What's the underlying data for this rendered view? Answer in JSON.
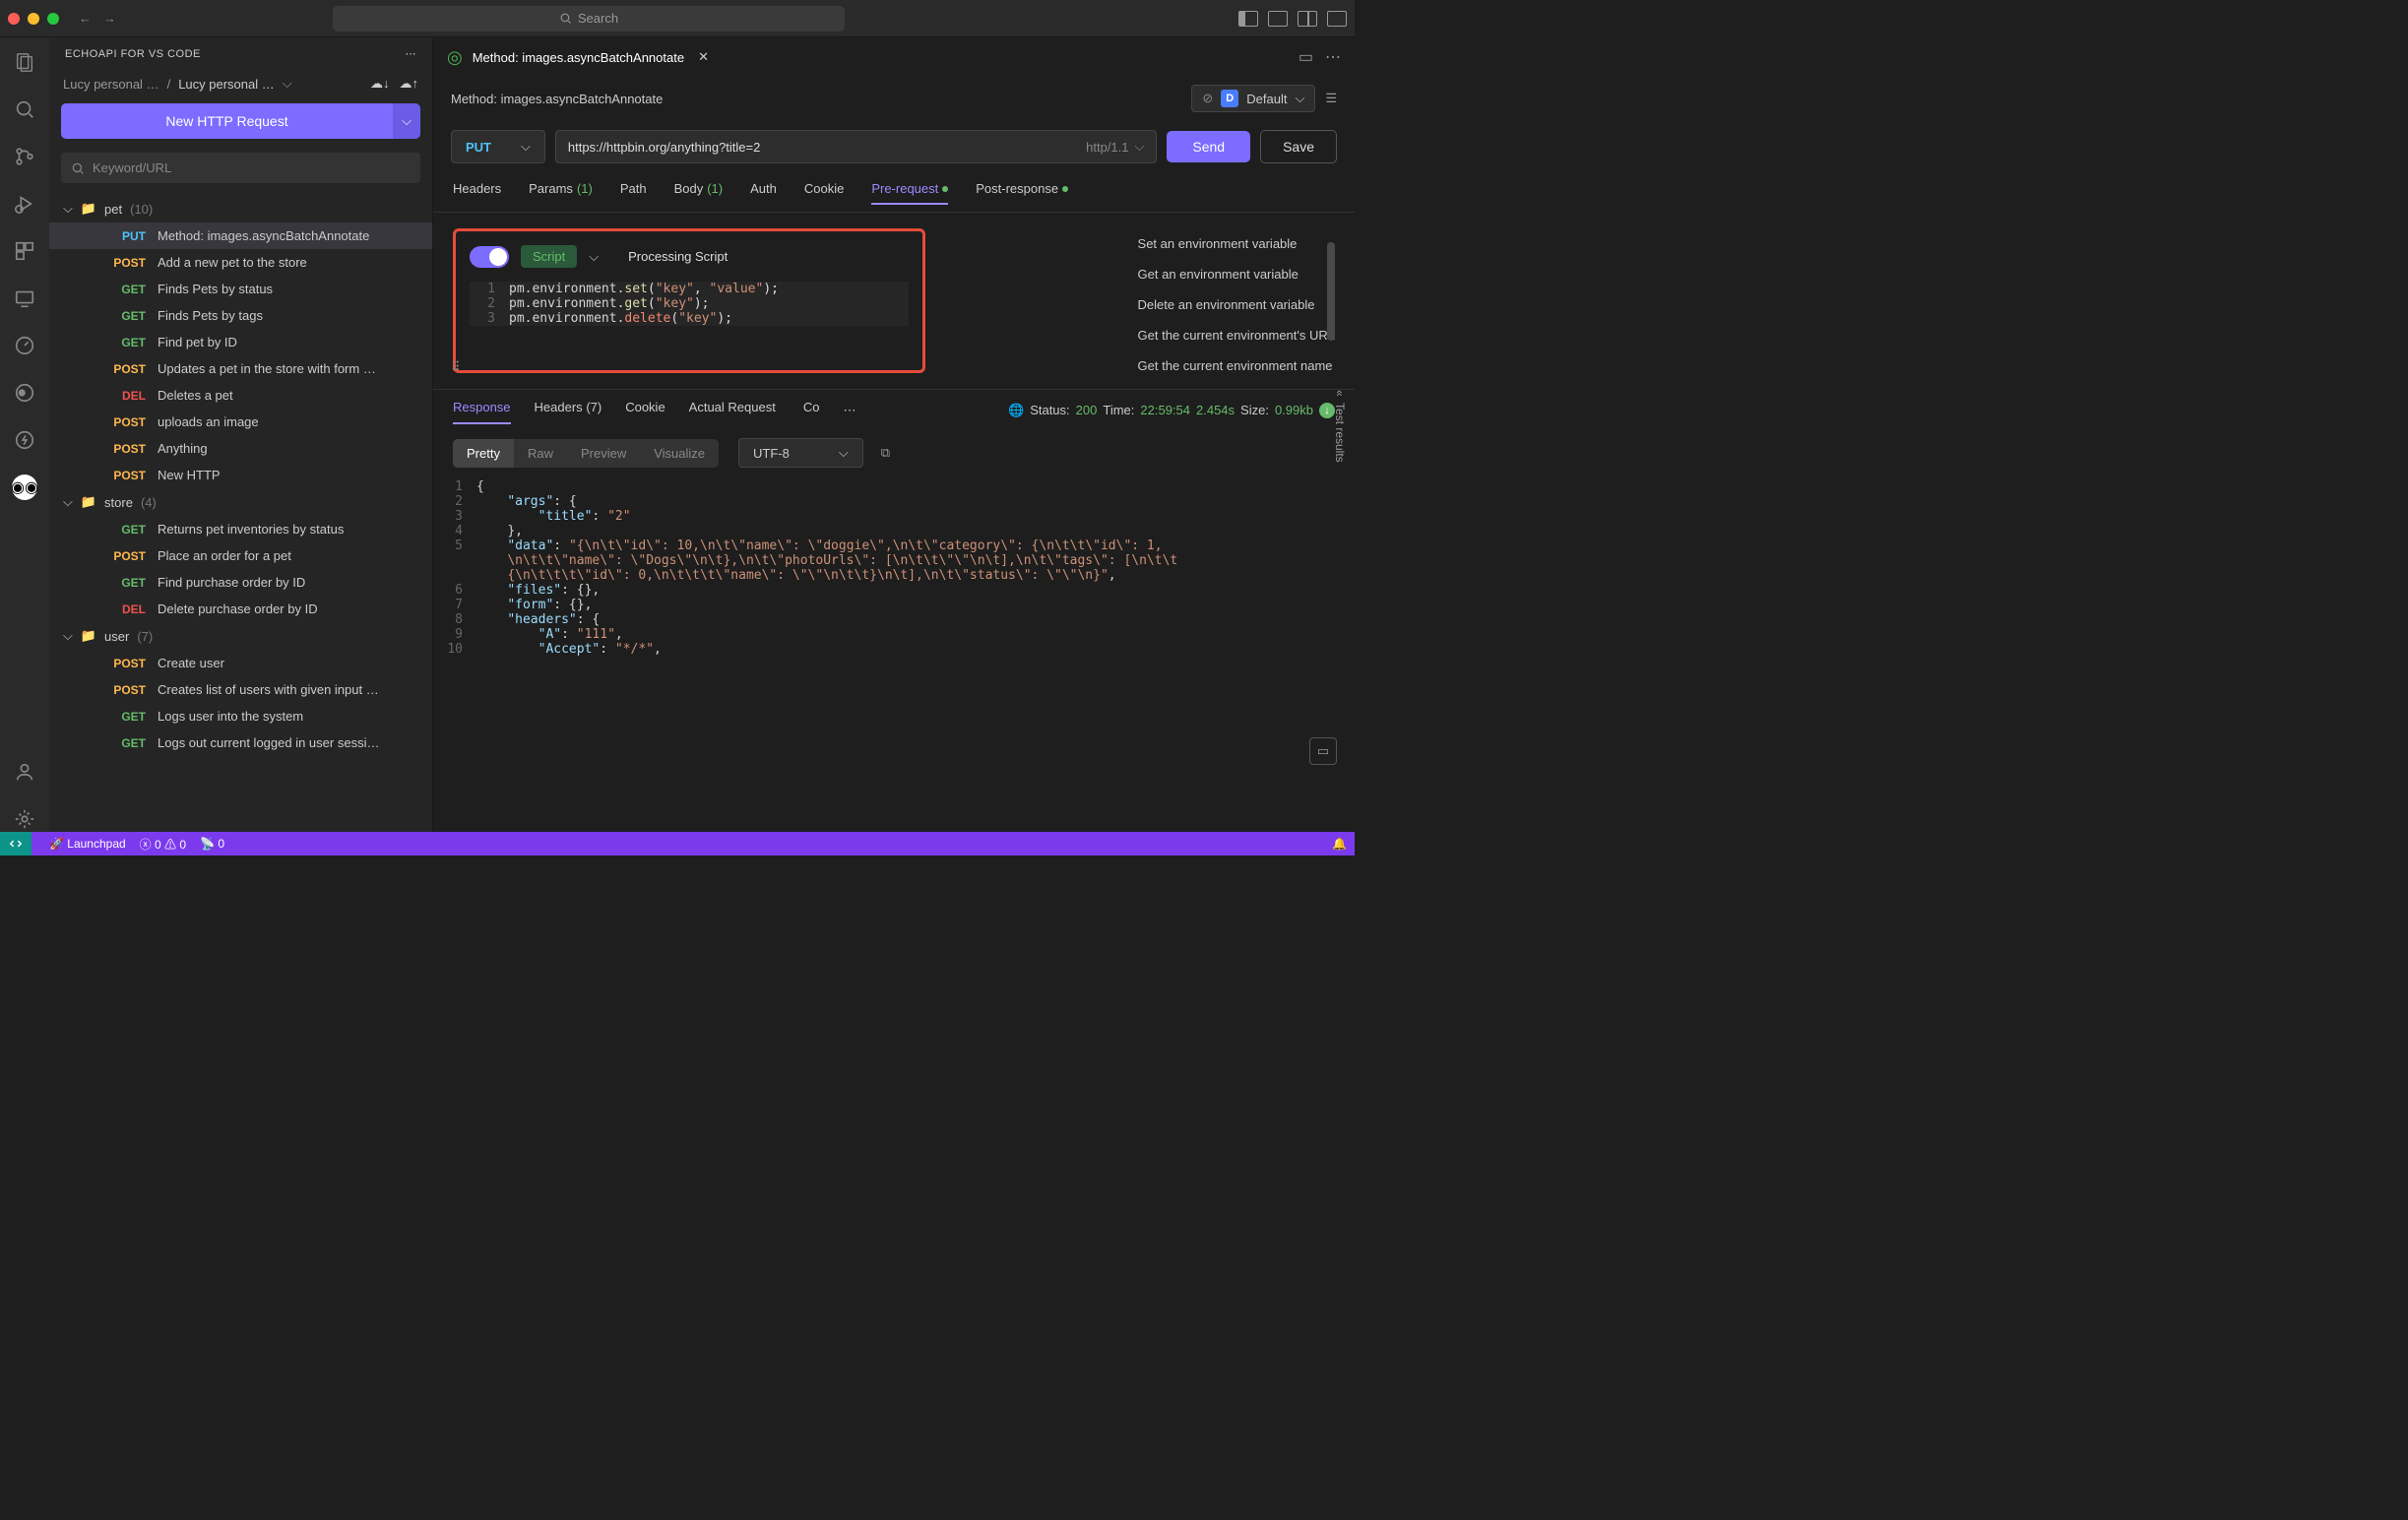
{
  "titlebar": {
    "search_placeholder": "Search"
  },
  "sidebar": {
    "title": "ECHOAPI FOR VS CODE",
    "crumb1": "Lucy personal …",
    "crumb2": "Lucy personal …",
    "new_http": "New HTTP Request",
    "filter_placeholder": "Keyword/URL",
    "folders": [
      {
        "name": "pet",
        "count": "(10)",
        "children": [
          {
            "m": "PUT",
            "label": "Method: images.asyncBatchAnnotate",
            "active": true
          },
          {
            "m": "POST",
            "label": "Add a new pet to the store"
          },
          {
            "m": "GET",
            "label": "Finds Pets by status"
          },
          {
            "m": "GET",
            "label": "Finds Pets by tags"
          },
          {
            "m": "GET",
            "label": "Find pet by ID"
          },
          {
            "m": "POST",
            "label": "Updates a pet in the store with form …"
          },
          {
            "m": "DEL",
            "label": "Deletes a pet"
          },
          {
            "m": "POST",
            "label": "uploads an image"
          },
          {
            "m": "POST",
            "label": "Anything"
          },
          {
            "m": "POST",
            "label": "New HTTP"
          }
        ]
      },
      {
        "name": "store",
        "count": "(4)",
        "children": [
          {
            "m": "GET",
            "label": "Returns pet inventories by status"
          },
          {
            "m": "POST",
            "label": "Place an order for a pet"
          },
          {
            "m": "GET",
            "label": "Find purchase order by ID"
          },
          {
            "m": "DEL",
            "label": "Delete purchase order by ID"
          }
        ]
      },
      {
        "name": "user",
        "count": "(7)",
        "children": [
          {
            "m": "POST",
            "label": "Create user"
          },
          {
            "m": "POST",
            "label": "Creates list of users with given input …"
          },
          {
            "m": "GET",
            "label": "Logs user into the system"
          },
          {
            "m": "GET",
            "label": "Logs out current logged in user sessi…"
          }
        ]
      }
    ]
  },
  "editor": {
    "tab_title": "Method: images.asyncBatchAnnotate",
    "breadcrumb": "Method: images.asyncBatchAnnotate",
    "env_label": "Default",
    "env_badge": "D",
    "method": "PUT",
    "url": "https://httpbin.org/anything?title=2",
    "proto": "http/1.1",
    "send": "Send",
    "save": "Save",
    "tabs": {
      "headers": "Headers",
      "params": "Params",
      "params_cnt": "(1)",
      "path": "Path",
      "body": "Body",
      "body_cnt": "(1)",
      "auth": "Auth",
      "cookie": "Cookie",
      "pre": "Pre-request",
      "post": "Post-response"
    },
    "script_label": "Script",
    "processing": "Processing Script",
    "snippets": [
      "Set an environment variable",
      "Get an environment variable",
      "Delete an environment variable",
      "Get the current environment's URL",
      "Get the current environment name"
    ],
    "response": {
      "tabs": {
        "response": "Response",
        "headers": "Headers",
        "headers_cnt": "(7)",
        "cookie": "Cookie",
        "actual": "Actual Request",
        "co": "Co"
      },
      "status_label": "Status:",
      "status": "200",
      "time_label": "Time:",
      "time1": "22:59:54",
      "time2": "2.454s",
      "size_label": "Size:",
      "size": "0.99kb",
      "seg": [
        "Pretty",
        "Raw",
        "Preview",
        "Visualize"
      ],
      "encoding": "UTF-8",
      "test_results": "Test results"
    }
  },
  "statusbar": {
    "launchpad": "Launchpad",
    "errors": "0",
    "warnings": "0",
    "radio": "0"
  }
}
